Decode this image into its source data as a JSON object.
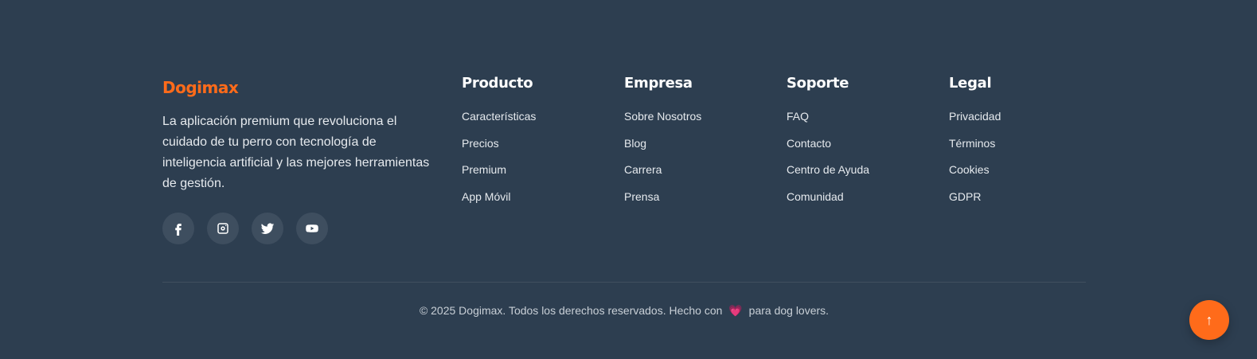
{
  "brand": {
    "name": "Dogimax",
    "description": "La aplicación premium que revoluciona el cuidado de tu perro con tecnología de inteligencia artificial y las mejores herramientas de gestión."
  },
  "social": [
    {
      "icon": "facebook-icon"
    },
    {
      "icon": "instagram-icon"
    },
    {
      "icon": "twitter-icon"
    },
    {
      "icon": "youtube-icon"
    }
  ],
  "columns": [
    {
      "title": "Producto",
      "links": [
        "Características",
        "Precios",
        "Premium",
        "App Móvil"
      ]
    },
    {
      "title": "Empresa",
      "links": [
        "Sobre Nosotros",
        "Blog",
        "Carrera",
        "Prensa"
      ]
    },
    {
      "title": "Soporte",
      "links": [
        "FAQ",
        "Contacto",
        "Centro de Ayuda",
        "Comunidad"
      ]
    },
    {
      "title": "Legal",
      "links": [
        "Privacidad",
        "Términos",
        "Cookies",
        "GDPR"
      ]
    }
  ],
  "copyright": {
    "before": "© 2025 Dogimax. Todos los derechos reservados. Hecho con",
    "heart": "💗",
    "after": "para dog lovers."
  },
  "scroll_top": {
    "icon": "arrow-up-icon",
    "glyph": "↑"
  },
  "colors": {
    "background": "#2d3e50",
    "accent": "#ff6b1a",
    "social_bg": "#3e4e5f"
  }
}
